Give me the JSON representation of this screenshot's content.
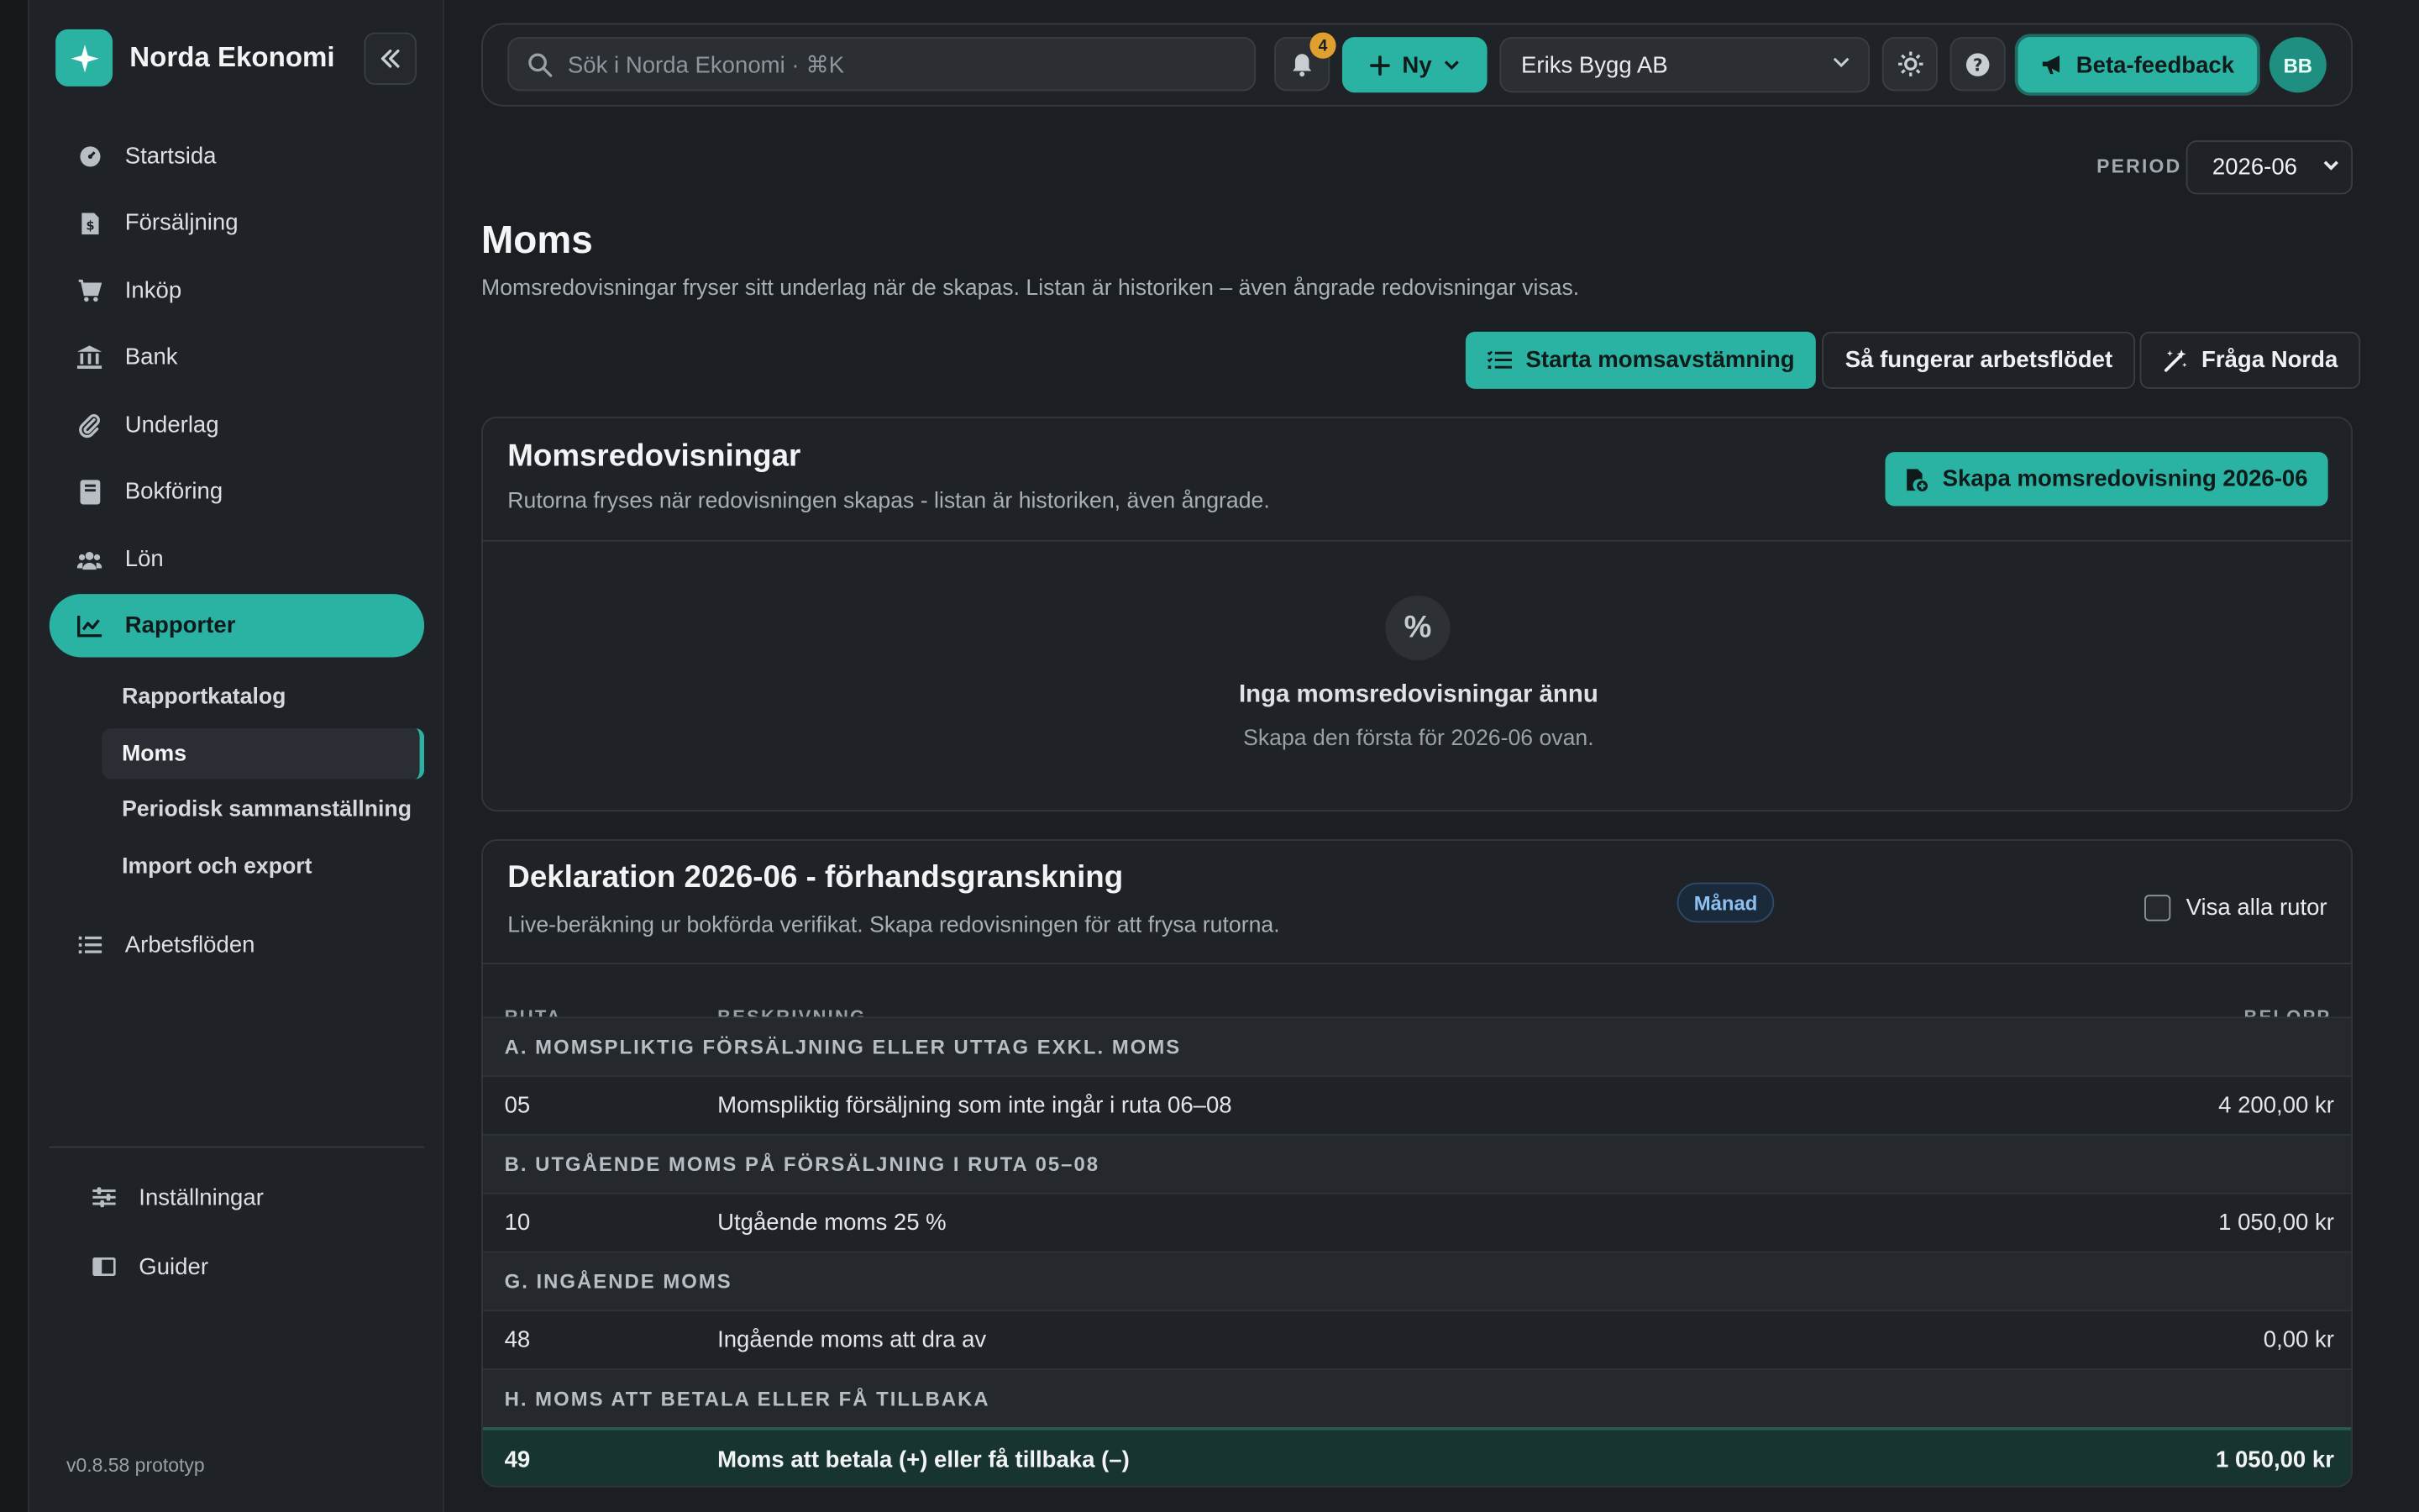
{
  "app": {
    "name": "Norda Ekonomi",
    "version": "v0.8.58 prototyp"
  },
  "nav": {
    "items": [
      {
        "label": "Startsida",
        "icon": "gauge-icon"
      },
      {
        "label": "Försäljning",
        "icon": "invoice-icon"
      },
      {
        "label": "Inköp",
        "icon": "cart-icon"
      },
      {
        "label": "Bank",
        "icon": "bank-icon"
      },
      {
        "label": "Underlag",
        "icon": "paperclip-icon"
      },
      {
        "label": "Bokföring",
        "icon": "book-icon"
      },
      {
        "label": "Lön",
        "icon": "people-icon"
      },
      {
        "label": "Rapporter",
        "icon": "chart-line-icon",
        "active": true
      }
    ],
    "sub_items": [
      {
        "label": "Rapportkatalog"
      },
      {
        "label": "Moms",
        "active": true
      },
      {
        "label": "Periodisk sammanställning"
      },
      {
        "label": "Import och export"
      }
    ],
    "workflows": {
      "label": "Arbetsflöden",
      "icon": "list-check-icon"
    },
    "footer": [
      {
        "label": "Inställningar",
        "icon": "sliders-icon"
      },
      {
        "label": "Guider",
        "icon": "book-open-icon"
      }
    ]
  },
  "topbar": {
    "search_placeholder": "Sök i Norda Ekonomi · ⌘K",
    "notifications_count": "4",
    "new_label": "Ny",
    "company": "Eriks Bygg AB",
    "beta_label": "Beta-feedback",
    "avatar_initials": "BB"
  },
  "period": {
    "label": "PERIOD",
    "value": "2026-06"
  },
  "page": {
    "title": "Moms",
    "subtitle": "Momsredovisningar fryser sitt underlag när de skapas. Listan är historiken – även ångrade redovisningar visas.",
    "actions": {
      "start": "Starta momsavstämning",
      "workflow": "Så fungerar arbetsflödet",
      "ask": "Fråga Norda"
    }
  },
  "reports_card": {
    "title": "Momsredovisningar",
    "subtitle": "Rutorna fryses när redovisningen skapas - listan är historiken, även ångrade.",
    "create_label": "Skapa momsredovisning 2026-06",
    "empty_icon": "%",
    "empty_title": "Inga momsredovisningar ännu",
    "empty_sub": "Skapa den första för 2026-06 ovan."
  },
  "declaration": {
    "title": "Deklaration 2026-06 - förhandsgranskning",
    "subtitle": "Live-beräkning ur bokförda verifikat. Skapa redovisningen för att frysa rutorna.",
    "badge": "Månad",
    "show_all_label": "Visa alla rutor",
    "show_all_checked": false,
    "columns": {
      "ruta": "RUTA",
      "description": "BESKRIVNING",
      "amount": "BELOPP"
    },
    "sections": [
      {
        "title": "A. MOMSPLIKTIG FÖRSÄLJNING ELLER UTTAG EXKL. MOMS",
        "rows": [
          {
            "ruta": "05",
            "description": "Momspliktig försäljning som inte ingår i ruta 06–08",
            "amount": "4 200,00 kr"
          }
        ]
      },
      {
        "title": "B. UTGÅENDE MOMS PÅ FÖRSÄLJNING I RUTA 05–08",
        "rows": [
          {
            "ruta": "10",
            "description": "Utgående moms 25 %",
            "amount": "1 050,00 kr"
          }
        ]
      },
      {
        "title": "G. INGÅENDE MOMS",
        "rows": [
          {
            "ruta": "48",
            "description": "Ingående moms att dra av",
            "amount": "0,00 kr"
          }
        ]
      },
      {
        "title": "H. MOMS ATT BETALA ELLER FÅ TILLBAKA",
        "rows": [
          {
            "ruta": "49",
            "description": "Moms att betala (+) eller få tillbaka (–)",
            "amount": "1 050,00 kr",
            "total": true
          }
        ]
      }
    ]
  },
  "colors": {
    "accent": "#2ab3a3",
    "background": "#1b1e22",
    "panel": "#1f2226",
    "badge": "#e0a030"
  }
}
